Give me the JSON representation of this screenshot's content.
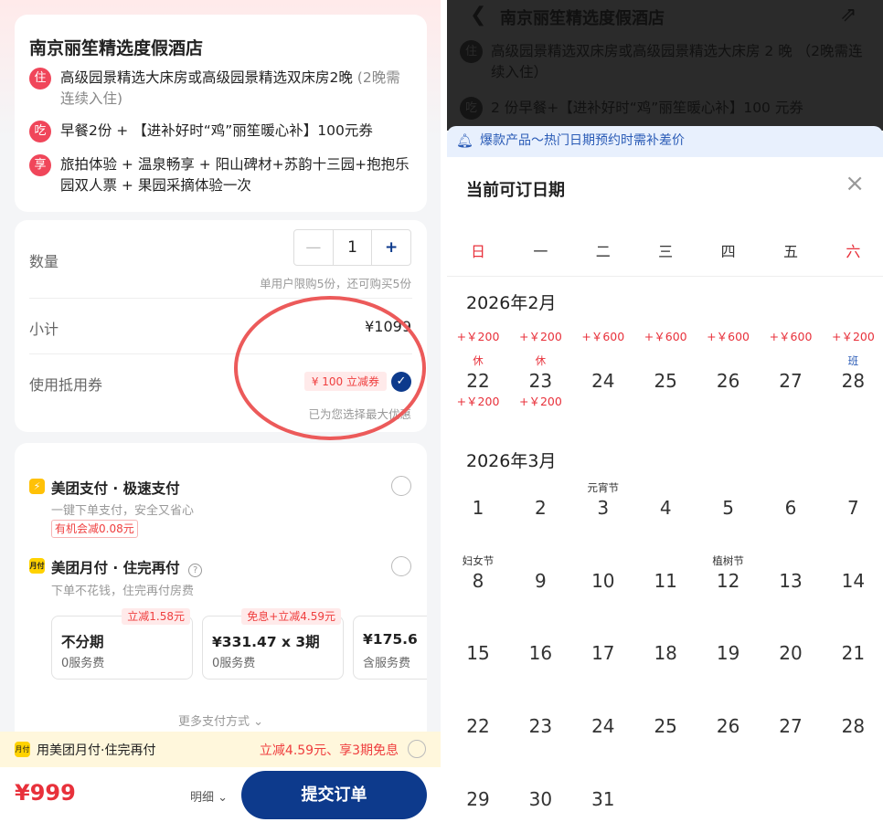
{
  "left": {
    "hotel_name": "南京丽笙精选度假酒店",
    "items": [
      {
        "tag": "住",
        "text": "高级园景精选大床房或高级园景精选双床房2晚",
        "note": " (2晚需连续入住)"
      },
      {
        "tag": "吃",
        "text": "早餐2份 + 【进补好时“鸡”丽笙暖心补】100元券",
        "note": ""
      },
      {
        "tag": "享",
        "text": "旅拍体验 + 温泉畅享 + 阳山碑材+苏韵十三园+抱抱乐园双人票 + 果园采摘体验一次",
        "note": ""
      }
    ],
    "qty_label": "数量",
    "qty_minus": "—",
    "qty_value": "1",
    "qty_plus": "+",
    "qty_limit": "单用户限购5份，还可购买5份",
    "subtotal_label": "小计",
    "subtotal_value": "¥1099",
    "coupon_label": "使用抵用券",
    "coupon_badge": "¥ 100 立减券",
    "coupon_note": "已为您选择最大优惠",
    "pay1": {
      "title": "美团支付 · 极速支付",
      "desc": "一键下单支付，安全又省心",
      "badge": "有机会减0.08元"
    },
    "pay2": {
      "icon": "月付",
      "title": "美团月付 · 住完再付",
      "desc": "下单不花钱，住完再付房费"
    },
    "plans": [
      {
        "badge": "立减1.58元",
        "title": "不分期",
        "sub": "0服务费"
      },
      {
        "badge": "免息+立减4.59元",
        "title": "¥331.47 x 3期",
        "sub": "0服务费"
      },
      {
        "badge": "",
        "title": "¥175.6",
        "sub": "含服务费"
      }
    ],
    "more_pay": "更多支付方式",
    "promo_icon": "月付",
    "promo_text": "用美团月付·住完再付",
    "promo_right": "立减4.59元、享3期免息",
    "total": "¥999",
    "detail": "明细",
    "submit": "提交订单"
  },
  "right": {
    "hotel_name": "南京丽笙精选度假酒店",
    "room_tag": "住",
    "room_text": "高级园景精选双床房或高级园景精选大床房 2 晚 （2晚需连续入住）",
    "meal_tag": "吃",
    "meal_text": "2 份早餐+【进补好时“鸡”丽笙暖心补】100 元券",
    "banner": "爆款产品～热门日期预约时需补差价",
    "sheet_title": "当前可订日期",
    "weekdays": [
      "日",
      "一",
      "二",
      "三",
      "四",
      "五",
      "六"
    ],
    "feb_title": "2026年2月",
    "feb": [
      {
        "d": "22",
        "top": "休",
        "price": "+￥200",
        "price2": "+￥200"
      },
      {
        "d": "23",
        "top": "休",
        "price": "+￥200",
        "price2": "+￥200"
      },
      {
        "d": "24",
        "top": "",
        "price": "+￥600",
        "price2": ""
      },
      {
        "d": "25",
        "top": "",
        "price": "+￥600",
        "price2": ""
      },
      {
        "d": "26",
        "top": "",
        "price": "+￥600",
        "price2": ""
      },
      {
        "d": "27",
        "top": "",
        "price": "+￥600",
        "price2": ""
      },
      {
        "d": "28",
        "top": "班",
        "price": "+￥200",
        "price2": ""
      }
    ],
    "mar_title": "2026年3月",
    "mar_rows": [
      [
        {
          "d": "1",
          "top": ""
        },
        {
          "d": "2",
          "top": ""
        },
        {
          "d": "3",
          "top": "元宵节"
        },
        {
          "d": "4",
          "top": ""
        },
        {
          "d": "5",
          "top": ""
        },
        {
          "d": "6",
          "top": ""
        },
        {
          "d": "7",
          "top": ""
        }
      ],
      [
        {
          "d": "8",
          "top": "妇女节"
        },
        {
          "d": "9",
          "top": ""
        },
        {
          "d": "10",
          "top": ""
        },
        {
          "d": "11",
          "top": ""
        },
        {
          "d": "12",
          "top": "植树节"
        },
        {
          "d": "13",
          "top": ""
        },
        {
          "d": "14",
          "top": ""
        }
      ],
      [
        {
          "d": "15",
          "top": ""
        },
        {
          "d": "16",
          "top": ""
        },
        {
          "d": "17",
          "top": ""
        },
        {
          "d": "18",
          "top": ""
        },
        {
          "d": "19",
          "top": ""
        },
        {
          "d": "20",
          "top": ""
        },
        {
          "d": "21",
          "top": ""
        }
      ],
      [
        {
          "d": "22",
          "top": ""
        },
        {
          "d": "23",
          "top": ""
        },
        {
          "d": "24",
          "top": ""
        },
        {
          "d": "25",
          "top": ""
        },
        {
          "d": "26",
          "top": ""
        },
        {
          "d": "27",
          "top": ""
        },
        {
          "d": "28",
          "top": ""
        }
      ],
      [
        {
          "d": "29",
          "top": ""
        },
        {
          "d": "30",
          "top": ""
        },
        {
          "d": "31",
          "top": ""
        }
      ]
    ]
  }
}
